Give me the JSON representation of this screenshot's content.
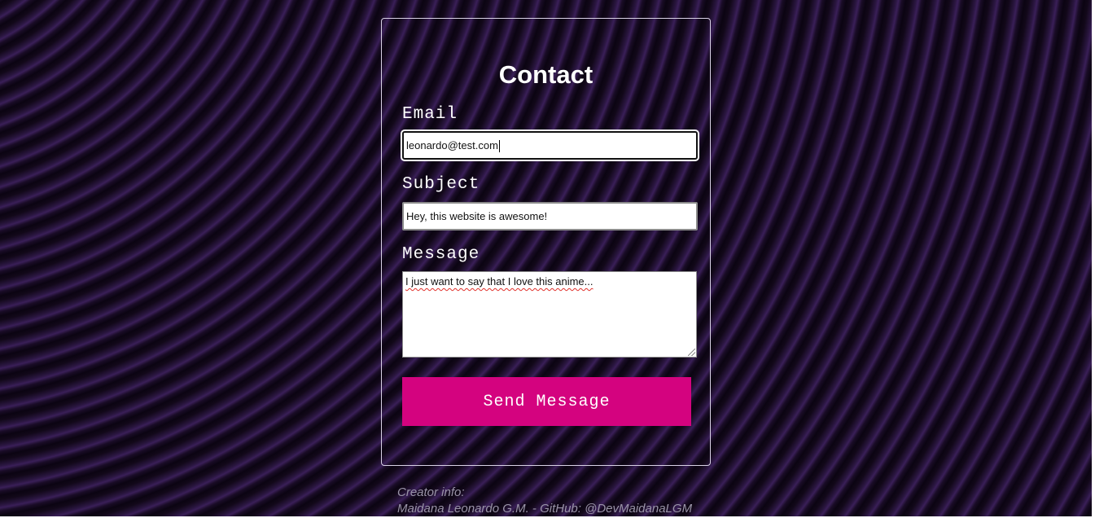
{
  "colors": {
    "background": "#160a22",
    "stripe_accent": "#3a1f58",
    "button": "#d4037f",
    "text": "#ffffff",
    "footer_text": "#9a94a8"
  },
  "contact_form": {
    "title": "Contact",
    "email": {
      "label": "Email",
      "value": "leonardo@test.com"
    },
    "subject": {
      "label": "Subject",
      "value": "Hey, this website is awesome!"
    },
    "message": {
      "label": "Message",
      "value": "I just want to say that I love this anime..."
    },
    "submit_label": "Send Message"
  },
  "footer": {
    "line1": "Creator info:",
    "line2": "Maidana Leonardo G.M. - GitHub: @DevMaidanaLGM"
  }
}
